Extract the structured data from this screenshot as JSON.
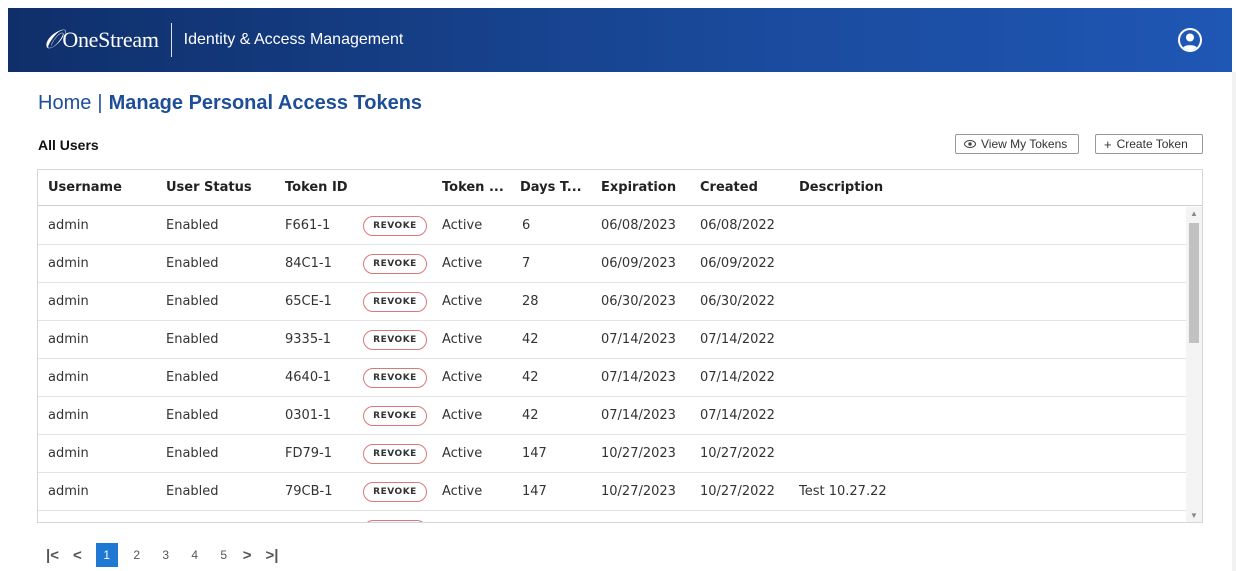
{
  "header": {
    "logo_text": "OneStream",
    "app_title": "Identity & Access Management",
    "user_icon": "user-circle-icon",
    "colors": {
      "bar_start": "#0f2f6a",
      "bar_end": "#1f57b5"
    }
  },
  "breadcrumb": {
    "home": "Home",
    "separator": "|",
    "current": "Manage Personal Access Tokens"
  },
  "section_label": "All Users",
  "toolbar": {
    "view_label": "View My Tokens",
    "view_icon": "eye-icon",
    "create_label": "Create Token",
    "create_icon": "plus-icon"
  },
  "table": {
    "columns": [
      "Username",
      "User Status",
      "Token ID",
      "Token ...",
      "Days T...",
      "Expiration",
      "Created",
      "Description"
    ],
    "revoke_label": "REVOKE",
    "rows": [
      {
        "username": "admin",
        "status": "Enabled",
        "token_id": "F661-1",
        "token_status": "Active",
        "days": "6",
        "expiration": "06/08/2023",
        "created": "06/08/2022",
        "description": ""
      },
      {
        "username": "admin",
        "status": "Enabled",
        "token_id": "84C1-1",
        "token_status": "Active",
        "days": "7",
        "expiration": "06/09/2023",
        "created": "06/09/2022",
        "description": ""
      },
      {
        "username": "admin",
        "status": "Enabled",
        "token_id": "65CE-1",
        "token_status": "Active",
        "days": "28",
        "expiration": "06/30/2023",
        "created": "06/30/2022",
        "description": ""
      },
      {
        "username": "admin",
        "status": "Enabled",
        "token_id": "9335-1",
        "token_status": "Active",
        "days": "42",
        "expiration": "07/14/2023",
        "created": "07/14/2022",
        "description": ""
      },
      {
        "username": "admin",
        "status": "Enabled",
        "token_id": "4640-1",
        "token_status": "Active",
        "days": "42",
        "expiration": "07/14/2023",
        "created": "07/14/2022",
        "description": ""
      },
      {
        "username": "admin",
        "status": "Enabled",
        "token_id": "0301-1",
        "token_status": "Active",
        "days": "42",
        "expiration": "07/14/2023",
        "created": "07/14/2022",
        "description": ""
      },
      {
        "username": "admin",
        "status": "Enabled",
        "token_id": "FD79-1",
        "token_status": "Active",
        "days": "147",
        "expiration": "10/27/2023",
        "created": "10/27/2022",
        "description": ""
      },
      {
        "username": "admin",
        "status": "Enabled",
        "token_id": "79CB-1",
        "token_status": "Active",
        "days": "147",
        "expiration": "10/27/2023",
        "created": "10/27/2022",
        "description": "Test 10.27.22"
      }
    ],
    "revoke_color": "#d97a7a"
  },
  "pager": {
    "first": "|<",
    "prev": "<",
    "next": ">",
    "last": ">|",
    "pages": [
      "1",
      "2",
      "3",
      "4",
      "5"
    ],
    "current_page": "1",
    "active_color": "#1f78d1"
  }
}
